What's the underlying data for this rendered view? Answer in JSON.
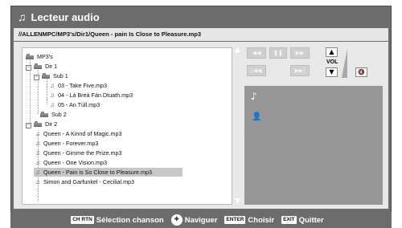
{
  "window": {
    "title": "Lecteur audio"
  },
  "path": "//ALLENMPC/MP3's/Dir1/Queen - pain Is Close to Pleasure.mp3",
  "tree": {
    "root": "MP3's",
    "dir1": "Dir 1",
    "sub1": "Sub 1",
    "sub1_files": [
      "03 - Take Five.mp3",
      "04 - Lá Breá Fán Dtuath.mp3",
      "05 - An Túll.mp3"
    ],
    "sub2": "Sub 2",
    "dir2": "Dir 2",
    "files": [
      "Queen - A Kinnd of Magic.mp3",
      "Queen - Forever.mp3",
      "Queen - Gimme the Prize.mp3",
      "Queen - One Vision.mp3",
      "Queen - Pain is So Close to Pleasure.mp3",
      "Simon and Garfunkel - Cecilial.mp3"
    ],
    "selected_index": 4,
    "toggle_collapsed": "+",
    "toggle_expanded": "−"
  },
  "controls": {
    "rewind": "◀◀",
    "pause": "❚❚",
    "forward": "▶▶",
    "prev": "|◀◀",
    "next": "▶▶|",
    "vol_up": "▲",
    "vol_label": "VOL",
    "vol_down": "▼",
    "mute_icon": "🔇"
  },
  "info": {
    "note_icon": "♪",
    "person_icon": "👤"
  },
  "footer": {
    "key1": "CH RTN",
    "label1": "Sélection chanson",
    "label2": "Naviguer",
    "key3": "ENTER",
    "label3": "Choisir",
    "key4": "EXIT",
    "label4": "Quitter"
  }
}
